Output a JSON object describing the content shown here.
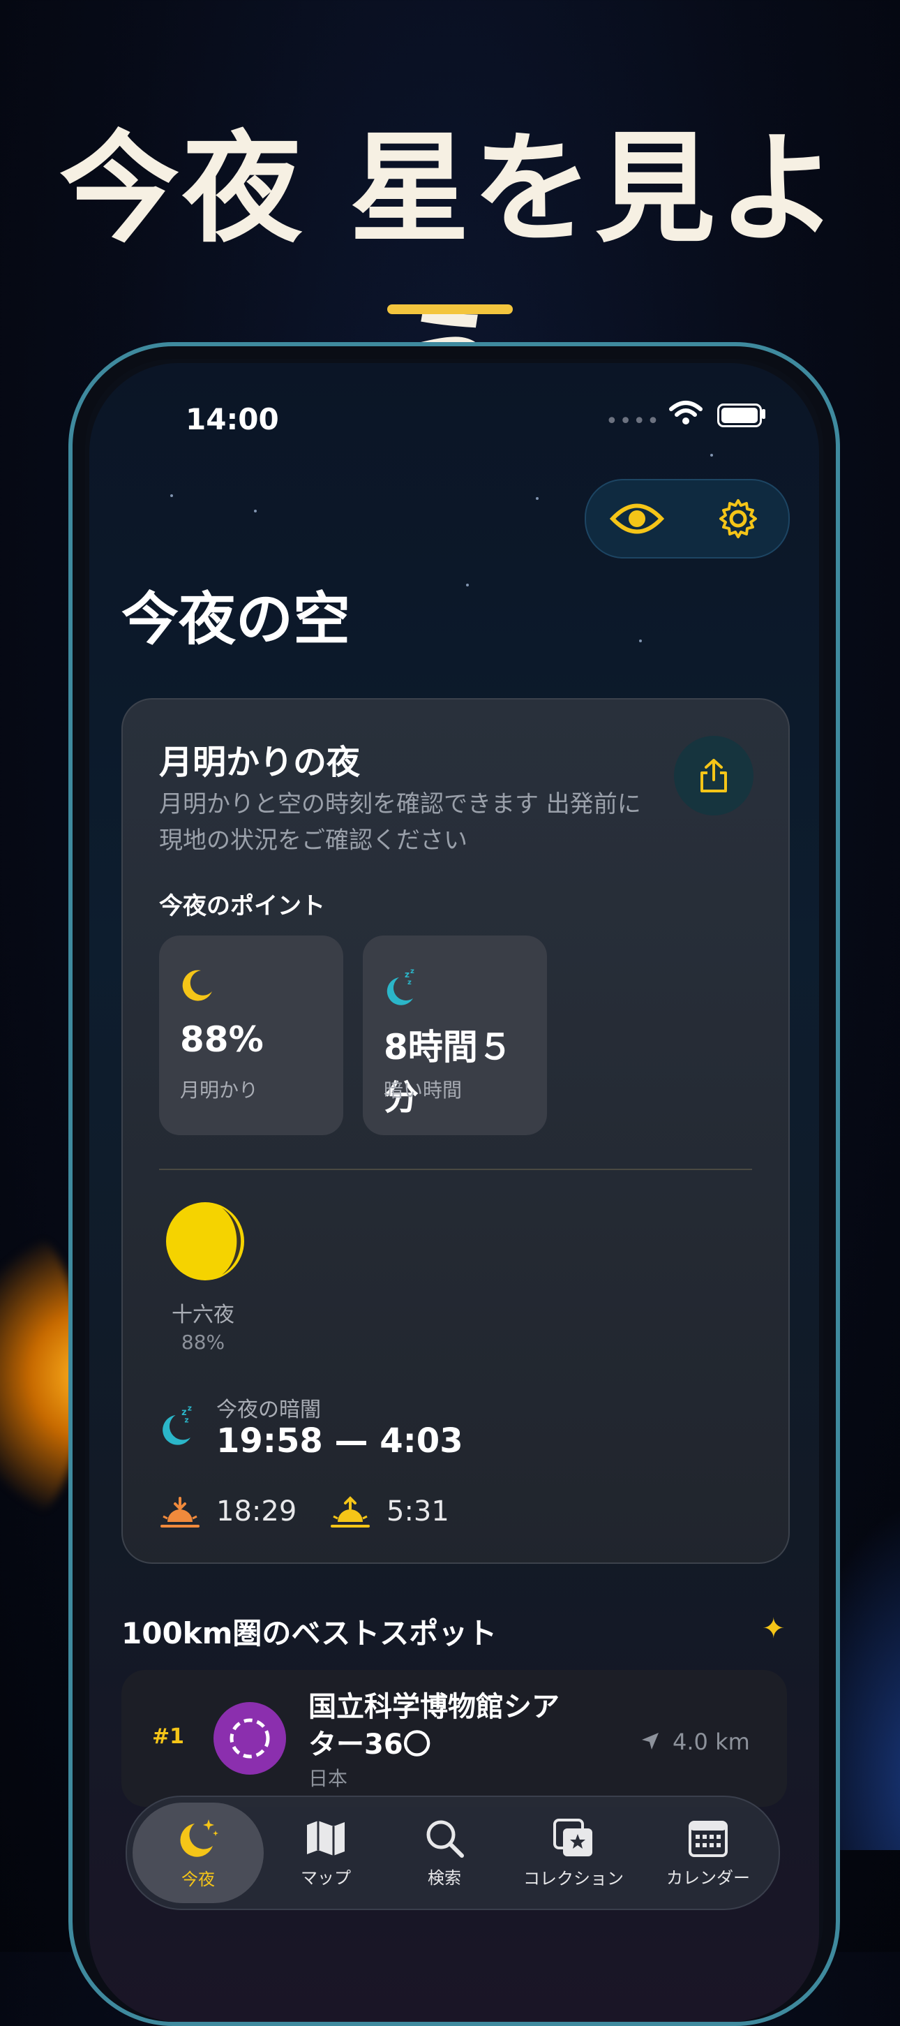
{
  "headline": "今夜 星を見よう",
  "status": {
    "time": "14:00"
  },
  "header": {
    "title": "今夜の空"
  },
  "card": {
    "title": "月明かりの夜",
    "subtitle": "月明かりと空の時刻を確認できます 出発前に現地の状況をご確認ください",
    "points_label": "今夜のポイント",
    "stats": [
      {
        "icon": "crescent-moon-icon",
        "value": "88%",
        "label": "月明かり"
      },
      {
        "icon": "sleep-moon-icon",
        "value": "8時間５分",
        "label": "暗い時間"
      }
    ],
    "moon_phase": {
      "name": "十六夜",
      "percent": "88%",
      "illumination": 0.88
    },
    "darkness": {
      "label": "今夜の暗闇",
      "value": "19:58 — 4:03"
    },
    "sunset": "18:29",
    "sunrise": "5:31"
  },
  "spots": {
    "title": "100km圏のベストスポット",
    "items": [
      {
        "rank": "#1",
        "name": "国立科学博物館シアター36〇",
        "country": "日本",
        "distance": "4.0 km"
      }
    ]
  },
  "tabs": [
    {
      "label": "今夜",
      "icon": "moon-stars-icon",
      "active": true
    },
    {
      "label": "マップ",
      "icon": "map-icon",
      "active": false
    },
    {
      "label": "検索",
      "icon": "search-icon",
      "active": false
    },
    {
      "label": "コレクション",
      "icon": "collection-icon",
      "active": false
    },
    {
      "label": "カレンダー",
      "icon": "calendar-icon",
      "active": false
    }
  ],
  "colors": {
    "accent": "#f5c518",
    "teal": "#2bb6c9",
    "orange": "#f08a3c"
  }
}
